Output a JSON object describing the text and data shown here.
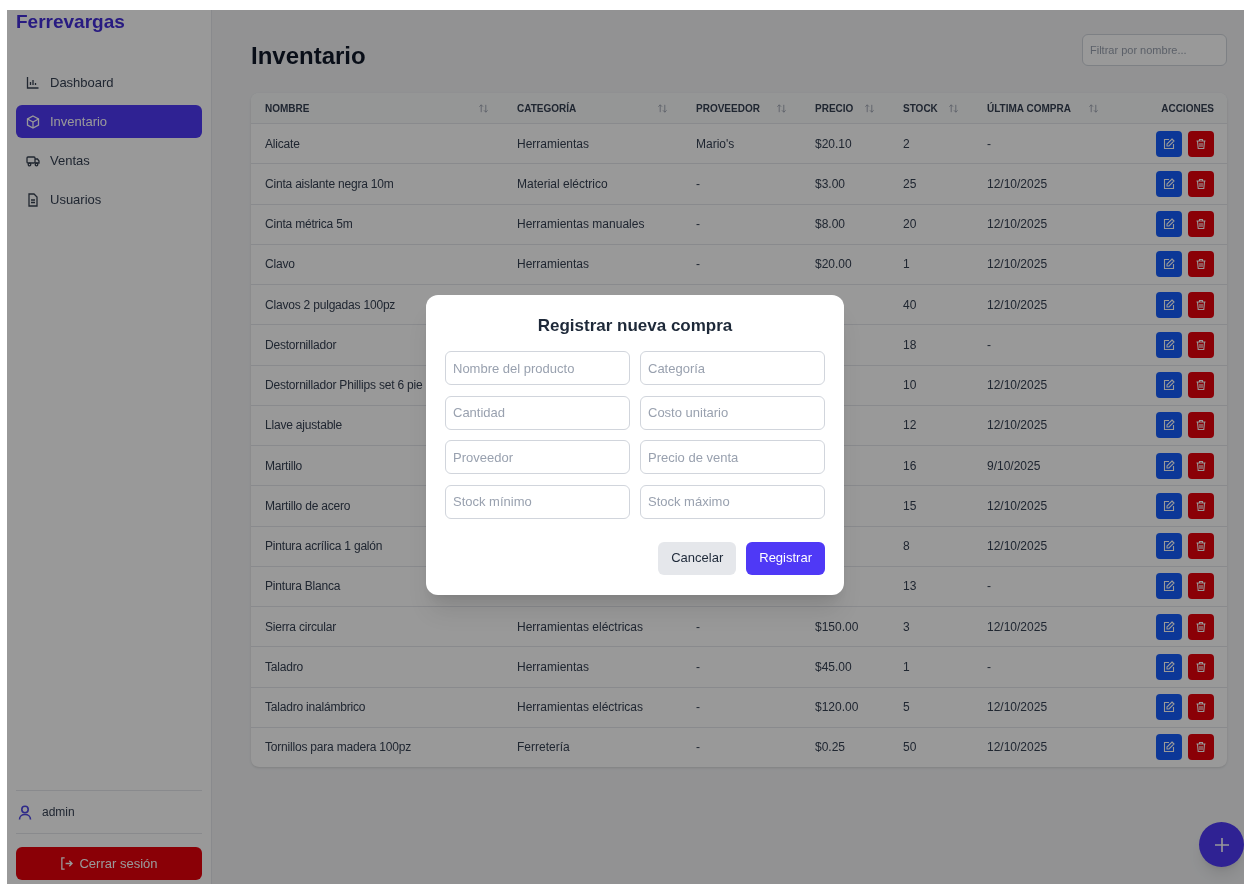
{
  "sidebar": {
    "brand": "Ferrevargas",
    "items": [
      {
        "label": "Dashboard",
        "selected": false
      },
      {
        "label": "Inventario",
        "selected": true
      },
      {
        "label": "Ventas",
        "selected": false
      },
      {
        "label": "Usuarios",
        "selected": false
      }
    ],
    "user": "admin",
    "logout": "Cerrar sesión"
  },
  "page": {
    "title": "Inventario",
    "filter": {
      "placeholder": "Filtrar por nombre..."
    }
  },
  "table": {
    "columns": [
      {
        "label": "NOMBRE",
        "sortable": true
      },
      {
        "label": "CATEGORÍA",
        "sortable": true
      },
      {
        "label": "PROVEEDOR",
        "sortable": true
      },
      {
        "label": "PRECIO",
        "sortable": true
      },
      {
        "label": "STOCK",
        "sortable": true
      },
      {
        "label": "ÚLTIMA COMPRA",
        "sortable": true
      },
      {
        "label": "ACCIONES",
        "sortable": false
      }
    ],
    "rows": [
      {
        "nombre": "Alicate",
        "categoria": "Herramientas",
        "proveedor": "Mario's",
        "precio": "$20.10",
        "stock": "2",
        "ultima_compra": "-"
      },
      {
        "nombre": "Cinta aislante negra 10m",
        "categoria": "Material eléctrico",
        "proveedor": "-",
        "precio": "$3.00",
        "stock": "25",
        "ultima_compra": "12/10/2025"
      },
      {
        "nombre": "Cinta métrica 5m",
        "categoria": "Herramientas manuales",
        "proveedor": "-",
        "precio": "$8.00",
        "stock": "20",
        "ultima_compra": "12/10/2025"
      },
      {
        "nombre": "Clavo",
        "categoria": "Herramientas",
        "proveedor": "-",
        "precio": "$20.00",
        "stock": "1",
        "ultima_compra": "12/10/2025"
      },
      {
        "nombre": "Clavos 2 pulgadas 100pz",
        "stock": "40",
        "ultima_compra": "12/10/2025"
      },
      {
        "nombre": "Destornillador",
        "stock": "18",
        "ultima_compra": "-"
      },
      {
        "nombre": "Destornillador Phillips set 6 pie",
        "stock": "10",
        "ultima_compra": "12/10/2025"
      },
      {
        "nombre": "Llave ajustable",
        "stock": "12",
        "ultima_compra": "12/10/2025"
      },
      {
        "nombre": "Martillo",
        "stock": "16",
        "ultima_compra": "9/10/2025"
      },
      {
        "nombre": "Martillo de acero",
        "stock": "15",
        "ultima_compra": "12/10/2025"
      },
      {
        "nombre": "Pintura acrílica 1 galón",
        "stock": "8",
        "ultima_compra": "12/10/2025"
      },
      {
        "nombre": "Pintura Blanca",
        "stock": "13",
        "ultima_compra": "-"
      },
      {
        "nombre": "Sierra circular",
        "categoria": "Herramientas eléctricas",
        "proveedor": "-",
        "precio": "$150.00",
        "stock": "3",
        "ultima_compra": "12/10/2025"
      },
      {
        "nombre": "Taladro",
        "categoria": "Herramientas",
        "proveedor": "-",
        "precio": "$45.00",
        "stock": "1",
        "ultima_compra": "-"
      },
      {
        "nombre": "Taladro inalámbrico",
        "categoria": "Herramientas eléctricas",
        "proveedor": "-",
        "precio": "$120.00",
        "stock": "5",
        "ultima_compra": "12/10/2025"
      },
      {
        "nombre": "Tornillos para madera 100pz",
        "categoria": "Ferretería",
        "proveedor": "-",
        "precio": "$0.25",
        "stock": "50",
        "ultima_compra": "12/10/2025"
      }
    ]
  },
  "modal": {
    "title": "Registrar nueva compra",
    "fields": [
      {
        "placeholder": "Nombre del producto"
      },
      {
        "placeholder": "Categoría"
      },
      {
        "placeholder": "Cantidad"
      },
      {
        "placeholder": "Costo unitario"
      },
      {
        "placeholder": "Proveedor"
      },
      {
        "placeholder": "Precio de venta"
      },
      {
        "placeholder": "Stock mínimo"
      },
      {
        "placeholder": "Stock máximo"
      }
    ],
    "buttons": [
      {
        "kind": "cancel",
        "label": "Cancelar"
      },
      {
        "kind": "submit",
        "label": "Registrar"
      }
    ]
  }
}
